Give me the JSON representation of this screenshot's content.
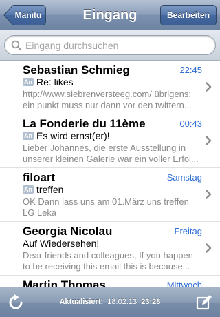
{
  "navbar": {
    "back_label": "Manitu",
    "title": "Eingang",
    "edit_label": "Bearbeiten"
  },
  "search": {
    "placeholder": "Eingang durchsuchen",
    "value": ""
  },
  "messages": [
    {
      "sender": "Sebastian Schmieg",
      "date": "22:45",
      "replied_badge": "An",
      "subject": "Re: likes",
      "preview": "http://www.siebrenversteeg.com/ übrigens: ein punkt muss nur dann vor den twittern..."
    },
    {
      "sender": "La Fonderie du 11ème",
      "date": "00:43",
      "replied_badge": "An",
      "subject": "Es wird ernst(er)!",
      "preview": "Lieber Johannes, die erste Ausstellung in unserer kleinen Galerie war ein voller Erfol..."
    },
    {
      "sender": "filoart",
      "date": "Samstag",
      "replied_badge": "An",
      "subject": "treffen",
      "preview": "OK Dann lass uns am 01.März uns treffen LG Leka"
    },
    {
      "sender": "Georgia Nicolau",
      "date": "Freitag",
      "replied_badge": "",
      "subject": "Auf Wiedersehen!",
      "preview": "Dear friends and colleagues, If you happen to be receiving this email  this is because..."
    },
    {
      "sender": "Martin Thomas",
      "date": "Mittwoch",
      "replied_badge": "",
      "subject": "",
      "preview": ""
    }
  ],
  "toolbar": {
    "updated_label": "Aktualisiert:",
    "updated_date": "18.02.13",
    "updated_time": "23:28",
    "refresh_icon": "refresh-icon",
    "compose_icon": "compose-icon"
  },
  "colors": {
    "date_blue": "#2f6ed7",
    "badge_bg": "#b1bfce",
    "preview_gray": "#8a8a8a"
  }
}
